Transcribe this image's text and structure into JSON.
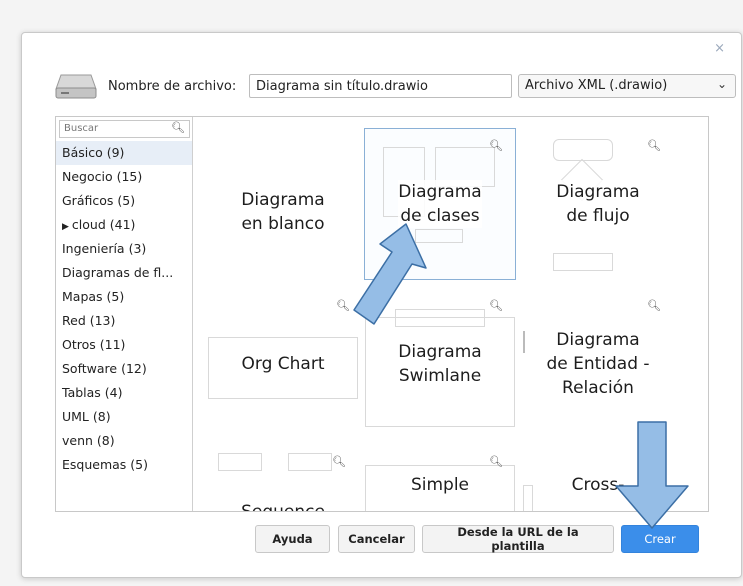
{
  "dialog": {
    "close_glyph": "×",
    "filename_label": "Nombre de archivo:",
    "filename_value": "Diagrama sin título.drawio",
    "format_value": "Archivo XML (.drawio)",
    "search_placeholder": "Buscar"
  },
  "sidebar": {
    "categories": [
      {
        "label": "Básico (9)",
        "selected": true
      },
      {
        "label": "Negocio (15)"
      },
      {
        "label": "Gráficos (5)"
      },
      {
        "label": "cloud (41)",
        "expandable": true
      },
      {
        "label": "Ingeniería (3)"
      },
      {
        "label": "Diagramas de fl..."
      },
      {
        "label": "Mapas (5)"
      },
      {
        "label": "Red (13)"
      },
      {
        "label": "Otros (11)"
      },
      {
        "label": "Software (12)"
      },
      {
        "label": "Tablas (4)"
      },
      {
        "label": "UML (8)"
      },
      {
        "label": "venn (8)"
      },
      {
        "label": "Esquemas (5)"
      }
    ]
  },
  "templates": {
    "blank": "Diagrama\nen blanco",
    "classes": "Diagrama\nde clases",
    "flow": "Diagrama\nde flujo",
    "org": "Org Chart",
    "swimlane": "Diagrama\nSwimlane",
    "er": "Diagrama\nde Entidad -\nRelación",
    "sequence": "Sequence",
    "simple": "Simple",
    "cross": "Cross-"
  },
  "buttons": {
    "help": "Ayuda",
    "cancel": "Cancelar",
    "from_url": "Desde la URL de la plantilla",
    "create": "Crear"
  },
  "colors": {
    "accent": "#3b8eea",
    "annotation_arrow_fill": "#95bde6",
    "annotation_arrow_stroke": "#3c6fa5",
    "selected_category": "#e7eef7"
  },
  "icons": {
    "drive": "hard-drive-icon",
    "search": "magnifier-icon",
    "dropdown": "chevron-down-icon"
  }
}
